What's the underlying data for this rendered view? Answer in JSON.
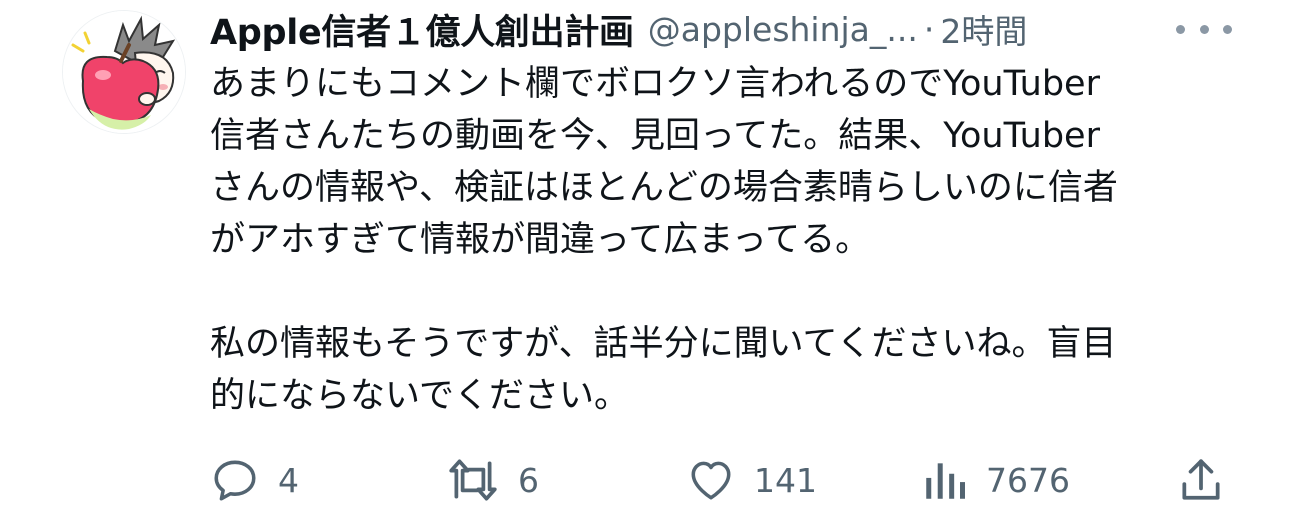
{
  "user": {
    "display_name": "Apple信者１億人創出計画",
    "handle": "@appleshinja_...",
    "separator": "·",
    "time": "2時間"
  },
  "tweet": {
    "lines": [
      "あまりにもコメント欄でボロクソ言われるのでYouTuber",
      "信者さんたちの動画を今、見回ってた。結果、YouTuber",
      "さんの情報や、検証はほとんどの場合素晴らしいのに信者",
      "がアホすぎて情報が間違って広まってる。",
      "私の情報もそうですが、話半分に聞いてくださいね。盲目",
      "的にならないでください。"
    ]
  },
  "actions": {
    "reply": {
      "icon": "reply-icon",
      "count": "4"
    },
    "retweet": {
      "icon": "retweet-icon",
      "count": "6"
    },
    "like": {
      "icon": "heart-icon",
      "count": "141"
    },
    "views": {
      "icon": "views-chart-icon",
      "count": "7676"
    },
    "share": {
      "icon": "share-icon"
    }
  },
  "colors": {
    "text_primary": "#0f1419",
    "text_secondary": "#536471"
  }
}
